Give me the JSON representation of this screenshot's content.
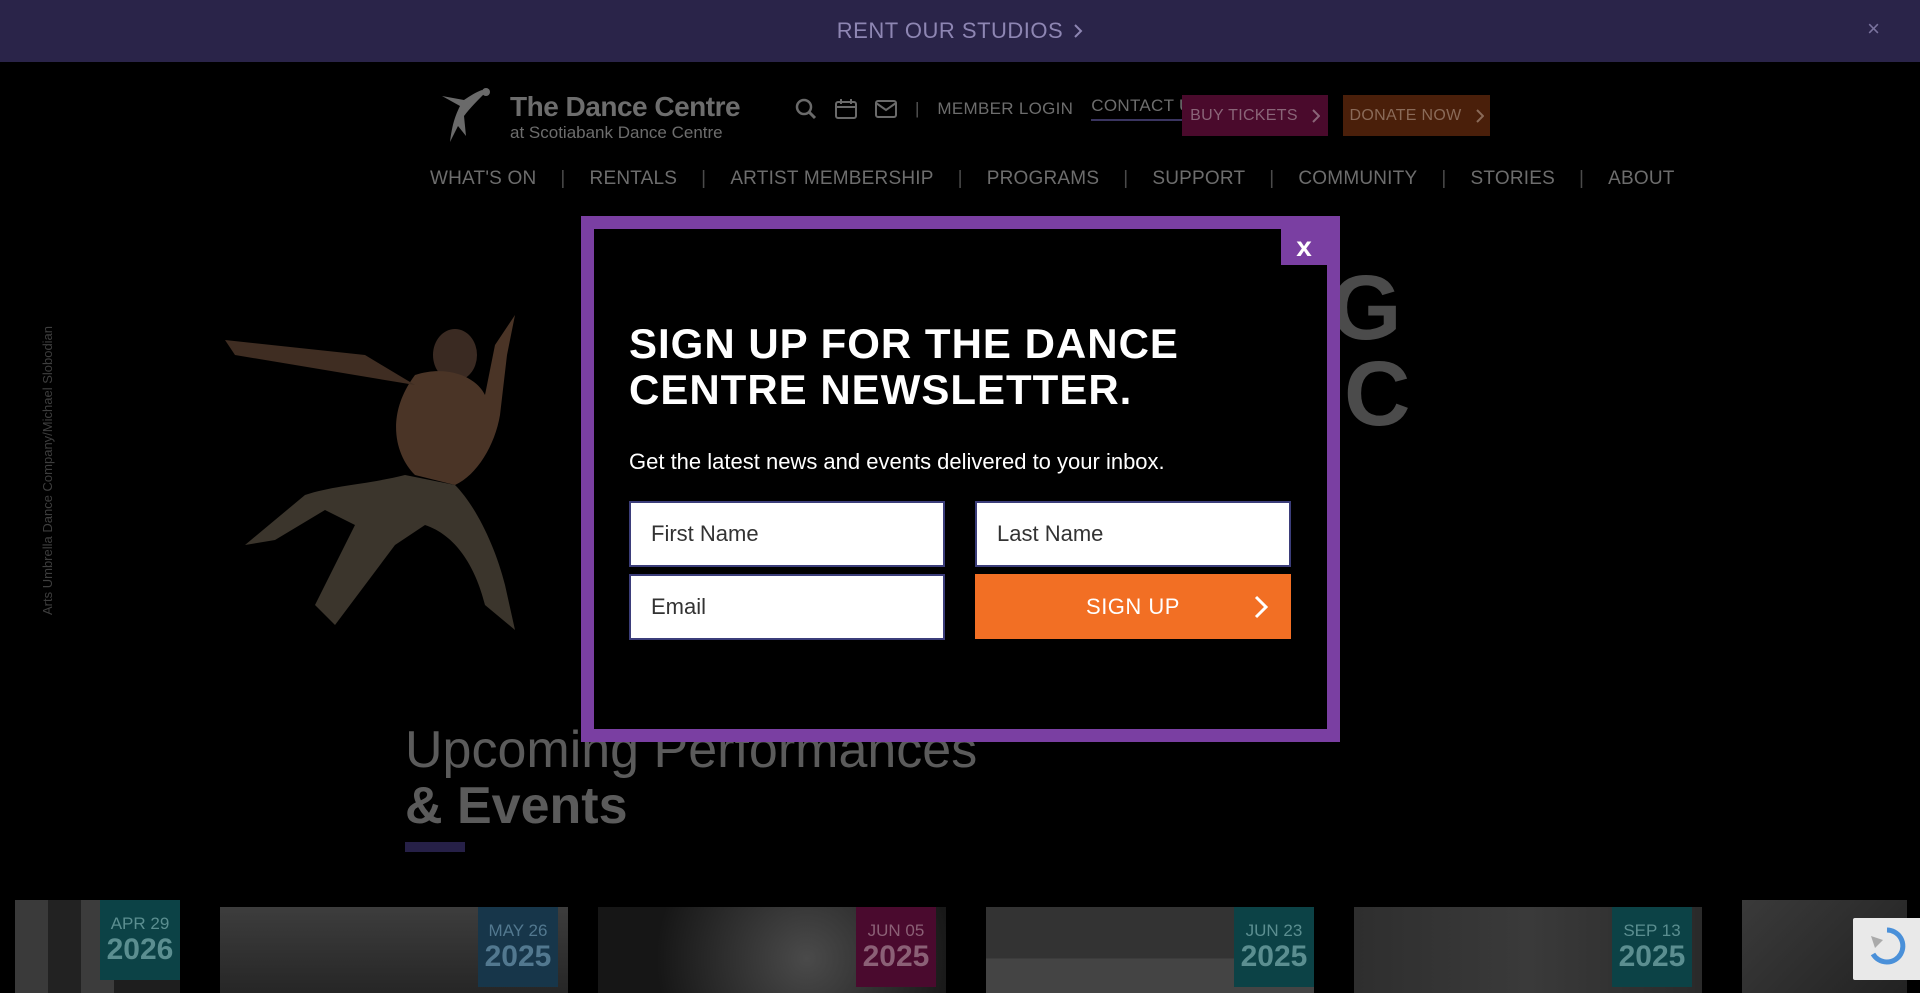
{
  "promo": {
    "text": "RENT OUR STUDIOS",
    "close": "×"
  },
  "logo": {
    "title": "The Dance Centre",
    "subtitle": "at Scotiabank Dance Centre"
  },
  "utility": {
    "separator": "|",
    "member_login": "MEMBER LOGIN",
    "contact_us": "CONTACT US",
    "buy_tickets": "BUY TICKETS",
    "donate_now": "DONATE NOW"
  },
  "nav": {
    "items": [
      {
        "label": "WHAT'S ON"
      },
      {
        "label": "RENTALS"
      },
      {
        "label": "ARTIST MEMBERSHIP"
      },
      {
        "label": "PROGRAMS"
      },
      {
        "label": "SUPPORT"
      },
      {
        "label": "COMMUNITY"
      },
      {
        "label": "STORIES"
      },
      {
        "label": "ABOUT"
      }
    ],
    "divider": "|"
  },
  "hero": {
    "credit": "Arts Umbrella Dance Company/Michael Slobodian",
    "letter1": "G",
    "letter2": "C"
  },
  "upcoming": {
    "line1": "Upcoming Performances",
    "line2": "& Events"
  },
  "events": [
    {
      "md": "APR 29",
      "yr": "2026"
    },
    {
      "md": "MAY 26",
      "yr": "2025"
    },
    {
      "md": "JUN 05",
      "yr": "2025"
    },
    {
      "md": "JUN 23",
      "yr": "2025"
    },
    {
      "md": "SEP 13",
      "yr": "2025"
    }
  ],
  "modal": {
    "close": "x",
    "title": "SIGN UP FOR THE DANCE CENTRE NEWSLETTER.",
    "subtitle": "Get the latest news and events delivered to your inbox.",
    "first_name": "First Name",
    "last_name": "Last Name",
    "email": "Email",
    "submit": "SIGN UP"
  },
  "colors": {
    "modal_border": "#7a3fa2",
    "signup_button": "#f26f24",
    "promo_bar": "#2a2449"
  }
}
